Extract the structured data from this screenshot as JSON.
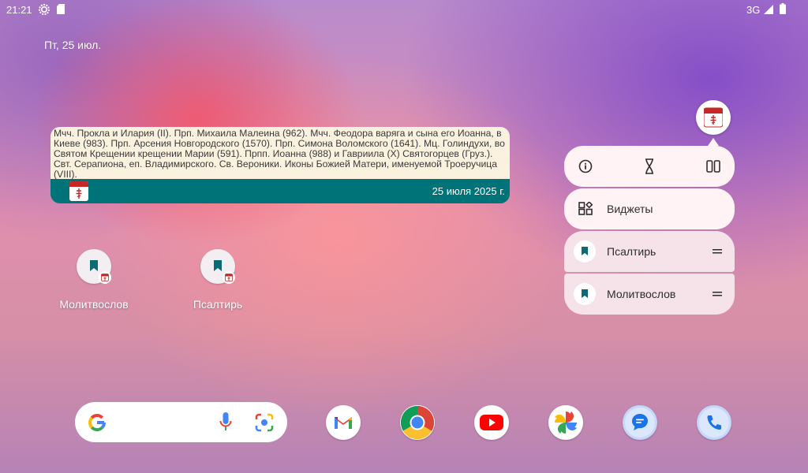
{
  "status_bar": {
    "time": "21:21",
    "network": "3G",
    "icons": [
      "gear-icon",
      "sd-card-icon",
      "signal-icon",
      "battery-icon"
    ]
  },
  "home": {
    "date": "Пт, 25 июл."
  },
  "calendar_widget": {
    "text": "Мчч. Прокла и Илария (II). Прп. Михаила Малеина (962). Мчч. Феодора варяга и сына его Иоанна, в Киеве (983). Прп. Арсения Новгородского (1570). Прп. Симона Воломского (1641). Мц. Голиндухи, во Святом Крещении крещении Марии (591). Прпп. Иоанна (988) и Гавриила (Х) Святогорцев (Груз.). Свт. Серапиона, еп. Владимирского. Св. Вероники. Иконы Божией Матери, именуемой Троеручица (VIII).",
    "date": "25 июля 2025 г.",
    "footer_color": "#007378"
  },
  "desktop_icons": [
    {
      "label": "Молитвослов"
    },
    {
      "label": "Псалтирь"
    }
  ],
  "popup_menu": {
    "actions": [
      "info-icon",
      "hourglass-icon",
      "split-screen-icon"
    ],
    "widgets_label": "Виджеты",
    "shortcuts": [
      {
        "label": "Псалтирь"
      },
      {
        "label": "Молитвослов"
      }
    ]
  },
  "dock": {
    "apps": [
      "gmail-icon",
      "chrome-icon",
      "youtube-icon",
      "photos-icon",
      "messages-icon",
      "phone-icon"
    ]
  },
  "colors": {
    "accent_teal": "#007378",
    "calendar_red": "#c62828"
  }
}
